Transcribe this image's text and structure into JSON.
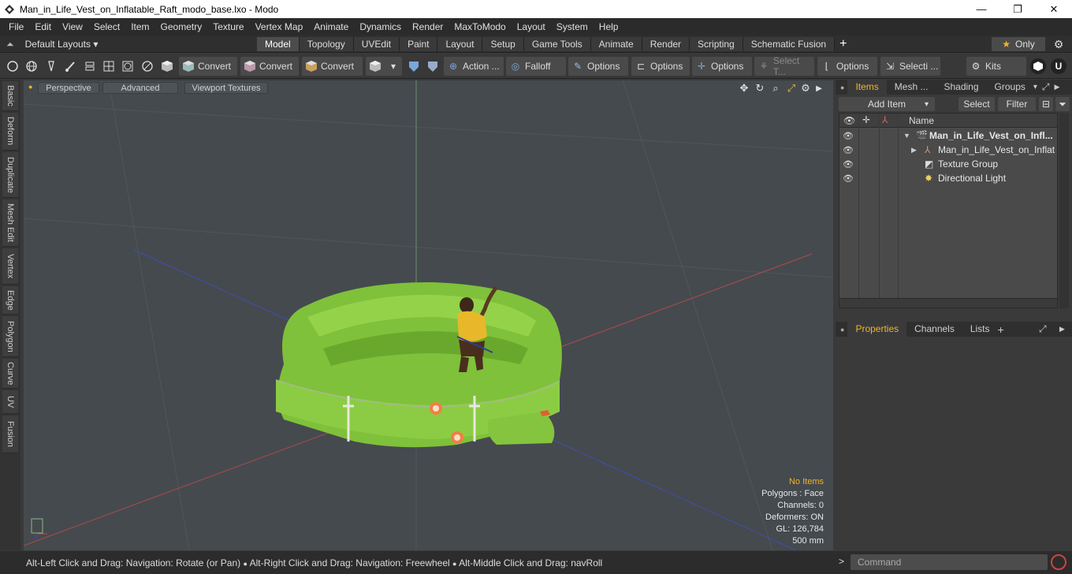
{
  "window": {
    "title": "Man_in_Life_Vest_on_Inflatable_Raft_modo_base.lxo - Modo",
    "minimize": "—",
    "maximize": "❐",
    "close": "✕"
  },
  "menu": [
    "File",
    "Edit",
    "View",
    "Select",
    "Item",
    "Geometry",
    "Texture",
    "Vertex Map",
    "Animate",
    "Dynamics",
    "Render",
    "MaxToModo",
    "Layout",
    "System",
    "Help"
  ],
  "layouts_label": "Default Layouts ▾",
  "tabs": [
    "Model",
    "Topology",
    "UVEdit",
    "Paint",
    "Layout",
    "Setup",
    "Game Tools",
    "Animate",
    "Render",
    "Scripting",
    "Schematic Fusion"
  ],
  "active_tab": "Model",
  "only_label": "Only",
  "toolbar": {
    "convert1": "Convert",
    "convert2": "Convert",
    "convert3": "Convert",
    "action": "Action ...",
    "falloff": "Falloff",
    "options1": "Options",
    "options2": "Options",
    "options3": "Options",
    "select_t": "Select T...",
    "options4": "Options",
    "selecti": "Selecti ...",
    "kits": "Kits"
  },
  "left_tabs": [
    "Basic",
    "Deform",
    "Duplicate",
    "Mesh Edit",
    "Vertex",
    "Edge",
    "Polygon",
    "Curve",
    "UV",
    "Fusion"
  ],
  "viewport": {
    "perspective": "Perspective",
    "advanced": "Advanced",
    "textures": "Viewport Textures",
    "stats": {
      "no_items": "No Items",
      "polygons": "Polygons : Face",
      "channels": "Channels: 0",
      "deformers": "Deformers: ON",
      "gl": "GL: 126,784",
      "scale": "500 mm"
    }
  },
  "right_panel": {
    "tabs": [
      "Items",
      "Mesh ...",
      "Shading",
      "Groups"
    ],
    "add_item": "Add Item",
    "select": "Select",
    "filter": "Filter",
    "name_header": "Name",
    "items": [
      {
        "label": "Man_in_Life_Vest_on_Infl...",
        "bold": true
      },
      {
        "label": "Man_in_Life_Vest_on_Inflat ...",
        "bold": false
      },
      {
        "label": "Texture Group",
        "bold": false
      },
      {
        "label": "Directional Light",
        "bold": false
      }
    ],
    "props_tabs": [
      "Properties",
      "Channels",
      "Lists"
    ]
  },
  "status": {
    "hint1": "Alt-Left Click and Drag: Navigation: Rotate (or Pan)",
    "hint2": "Alt-Right Click and Drag: Navigation: Freewheel",
    "hint3": "Alt-Middle Click and Drag: navRoll",
    "command_placeholder": "Command",
    "prompt": ">"
  }
}
